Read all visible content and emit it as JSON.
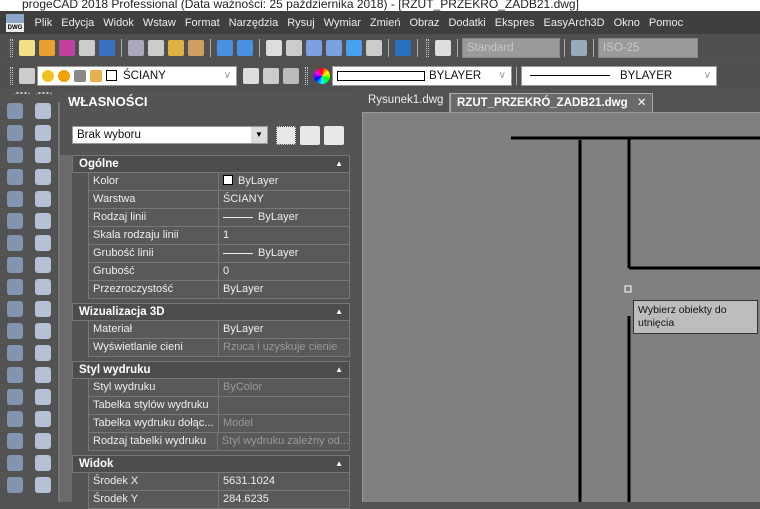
{
  "window": {
    "title": "progeCAD 2018 Professional  (Data ważności: 25 października 2018) - [RZUT_PRZEKRÓ_ZADB21.dwg]"
  },
  "menu": {
    "logo": "DWG",
    "items": [
      "Plik",
      "Edycja",
      "Widok",
      "Wstaw",
      "Format",
      "Narzędzia",
      "Rysuj",
      "Wymiar",
      "Zmień",
      "Obraz",
      "Dodatki",
      "Ekspres",
      "EasyArch3D",
      "Okno",
      "Pomoc"
    ]
  },
  "toolbar": {
    "text_style": "Standard",
    "dim_style": "ISO-25",
    "layer": "ŚCIANY",
    "color": "BYLAYER",
    "linetype": "BYLAYER",
    "icons": [
      "new-icon",
      "open-icon",
      "save-icon",
      "print-icon",
      "print-preview-icon",
      "cut-icon",
      "copy-icon",
      "paste-icon",
      "match-properties-icon",
      "undo-icon",
      "redo-icon",
      "pan-icon",
      "zoom-realtime-icon",
      "zoom-window-icon",
      "zoom-previous-icon",
      "regen-icon",
      "properties-icon",
      "help-icon",
      "text-style-icon"
    ]
  },
  "properties": {
    "title": "WŁASNOŚCI",
    "selection": "Brak wyboru",
    "sections": [
      {
        "name": "Ogólne",
        "rows": [
          {
            "k": "Kolor",
            "v": "ByLayer",
            "swatch": true
          },
          {
            "k": "Warstwa",
            "v": "ŚCIANY"
          },
          {
            "k": "Rodzaj linii",
            "v": "ByLayer",
            "line": true
          },
          {
            "k": "Skala rodzaju linii",
            "v": "1"
          },
          {
            "k": "Grubość linii",
            "v": "ByLayer",
            "line": true
          },
          {
            "k": "Grubość",
            "v": "0"
          },
          {
            "k": "Przezroczystość",
            "v": "ByLayer"
          }
        ]
      },
      {
        "name": "Wizualizacja 3D",
        "rows": [
          {
            "k": "Materiał",
            "v": "ByLayer"
          },
          {
            "k": "Wyświetlanie cieni",
            "v": "Rzuca i uzyskuje cienie",
            "dim": true
          }
        ]
      },
      {
        "name": "Styl wydruku",
        "rows": [
          {
            "k": "Styl wydruku",
            "v": "ByColor",
            "dim": true
          },
          {
            "k": "Tabelka stylów wydruku",
            "v": ""
          },
          {
            "k": "Tabelka wydruku dołąc...",
            "v": "Model",
            "dim": true
          },
          {
            "k": "Rodzaj tabelki wydruku",
            "v": "Styl wydruku zależny od...",
            "dim": true
          }
        ]
      },
      {
        "name": "Widok",
        "rows": [
          {
            "k": "Środek X",
            "v": "5631.1024"
          },
          {
            "k": "Środek Y",
            "v": "284.6235"
          }
        ]
      }
    ]
  },
  "tabs": [
    {
      "label": "Rysunek1.dwg"
    },
    {
      "label": "RZUT_PRZEKRÓ_ZADB21.dwg",
      "active": true
    }
  ],
  "tooltip": "Wybierz obiekty do utnięcia"
}
